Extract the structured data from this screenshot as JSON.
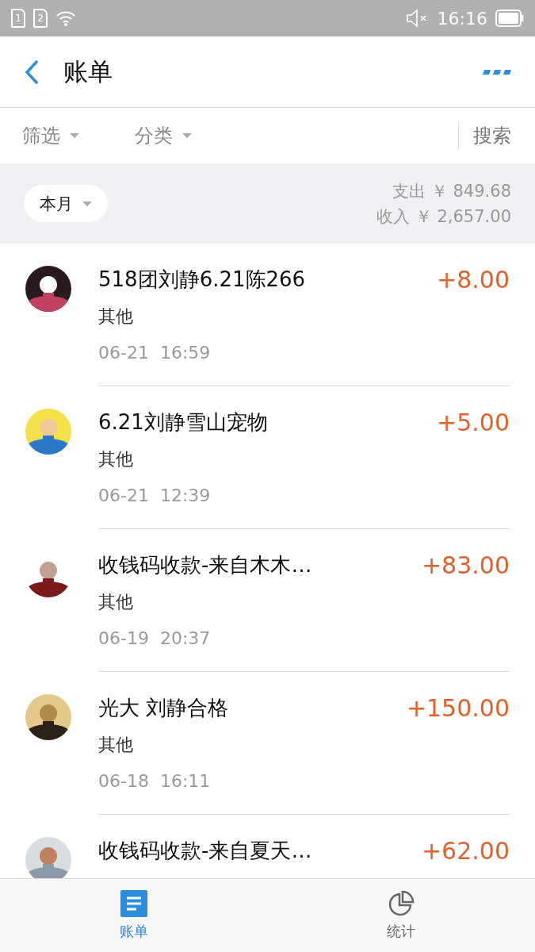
{
  "status_bar": {
    "time": "16:16",
    "sim_slots": [
      "1",
      "2"
    ],
    "muted": true
  },
  "header": {
    "title": "账单"
  },
  "filters": [
    {
      "label": "筛选"
    },
    {
      "label": "分类"
    }
  ],
  "search": {
    "label": "搜索"
  },
  "summary": {
    "period": "本月",
    "expense": "支出 ￥ 849.68",
    "income": "收入 ￥ 2,657.00"
  },
  "transactions": [
    {
      "title": "518团刘静6.21陈266",
      "category": "其他",
      "date": "06-21",
      "time": "16:59",
      "amount": "+8.00"
    },
    {
      "title": "6.21刘静雪山宠物",
      "category": "其他",
      "date": "06-21",
      "time": "12:39",
      "amount": "+5.00"
    },
    {
      "title": "收钱码收款-来自木木…",
      "category": "其他",
      "date": "06-19",
      "time": "20:37",
      "amount": "+83.00"
    },
    {
      "title": "光大 刘静合格",
      "category": "其他",
      "date": "06-18",
      "time": "16:11",
      "amount": "+150.00"
    },
    {
      "title": "收钱码收款-来自夏天…",
      "amount": "+62.00"
    }
  ],
  "tab_bar": [
    {
      "label": "账单",
      "kind": "bill",
      "selected": true
    },
    {
      "label": "统计",
      "kind": "stats",
      "selected": false
    }
  ]
}
